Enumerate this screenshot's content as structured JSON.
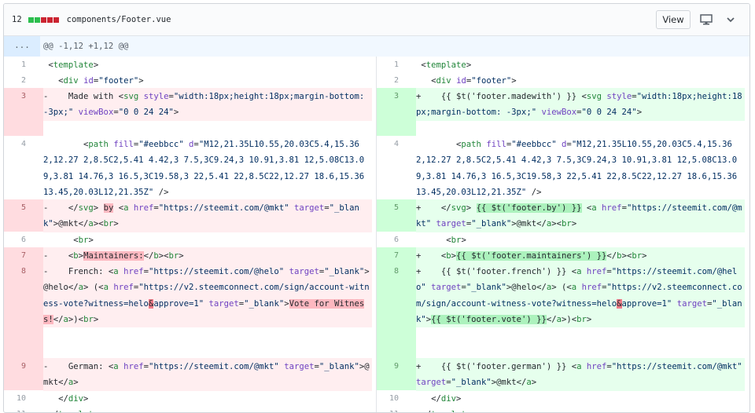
{
  "file": {
    "count": "12",
    "name": "components/Footer.vue",
    "diffstat_colors": [
      "#2cbe4e",
      "#2cbe4e",
      "#cb2431",
      "#cb2431",
      "#cb2431"
    ],
    "view_label": "View",
    "icons": [
      "desktop-icon",
      "chevron-down-icon"
    ]
  },
  "hunk": {
    "marker": "...",
    "header": "@@ -1,12 +1,12 @@"
  },
  "left": [
    {
      "num": "1",
      "text": " <template>"
    },
    {
      "num": "2",
      "text": "   <div id=\"footer\">"
    },
    {
      "num": "3",
      "sign": "-",
      "text": "      Made with <svg style=\"width:18px;height:18px;margin-bottom: -3px;\" viewBox=\"0 0 24 24\">"
    },
    {
      "num": "4",
      "text": "        <path fill=\"#eebbcc\" d=\"M12,21.35L10.55,20.03C5.4,15.36 2,12.27 2,8.5C2,5.41 4.42,3 7.5,3C9.24,3 10.91,3.81 12,5.08C13.09,3.81 14.76,3 16.5,3C19.58,3 22,5.41 22,8.5C22,12.27 18.6,15.36 13.45,20.03L12,21.35Z\" />"
    },
    {
      "num": "5",
      "sign": "-",
      "text": "      </svg> by <a href=\"https://steemit.com/@mkt\" target=\"_blank\">@mkt</a><br>"
    },
    {
      "num": "6",
      "text": "      <br>"
    },
    {
      "num": "7",
      "sign": "-",
      "text": "      <b>Maintainers:</b><br>"
    },
    {
      "num": "8",
      "sign": "-",
      "text": "      French: <a href=\"https://steemit.com/@helo\" target=\"_blank\">@helo</a> (<a href=\"https://v2.steemconnect.com/sign/account-witness-vote?witness=helo&approve=1\" target=\"_blank\">Vote for Witness!</a>)<br>"
    },
    {
      "num": "9",
      "sign": "-",
      "text": "      German: <a href=\"https://steemit.com/@mkt\" target=\"_blank\">@mkt</a>"
    },
    {
      "num": "10",
      "text": "   </div>"
    },
    {
      "num": "11",
      "text": " </template>"
    }
  ],
  "right": [
    {
      "num": "1",
      "text": " <template>"
    },
    {
      "num": "2",
      "text": "   <div id=\"footer\">"
    },
    {
      "num": "3",
      "sign": "+",
      "text": "      {{ $t('footer.madewith') }} <svg style=\"width:18px;height:18px;margin-bottom: -3px;\" viewBox=\"0 0 24 24\">"
    },
    {
      "num": "4",
      "text": "        <path fill=\"#eebbcc\" d=\"M12,21.35L10.55,20.03C5.4,15.36 2,12.27 2,8.5C2,5.41 4.42,3 7.5,3C9.24,3 10.91,3.81 12,5.08C13.09,3.81 14.76,3 16.5,3C19.58,3 22,5.41 22,8.5C22,12.27 18.6,15.36 13.45,20.03L12,21.35Z\" />"
    },
    {
      "num": "5",
      "sign": "+",
      "text": "      </svg> {{ $t('footer.by') }} <a href=\"https://steemit.com/@mkt\" target=\"_blank\">@mkt</a><br>"
    },
    {
      "num": "6",
      "text": "      <br>"
    },
    {
      "num": "7",
      "sign": "+",
      "text": "      <b>{{ $t('footer.maintainers') }}</b><br>"
    },
    {
      "num": "8",
      "sign": "+",
      "text": "      {{ $t('footer.french') }} <a href=\"https://steemit.com/@helo\" target=\"_blank\">@helo</a> (<a href=\"https://v2.steemconnect.com/sign/account-witness-vote?witness=helo&approve=1\" target=\"_blank\">{{ $t('footer.vote') }}</a>)<br>"
    },
    {
      "num": "9",
      "sign": "+",
      "text": "      {{ $t('footer.german') }} <a href=\"https://steemit.com/@mkt\" target=\"_blank\">@mkt</a>"
    },
    {
      "num": "10",
      "text": "   </div>"
    },
    {
      "num": "11",
      "text": " </template>"
    }
  ]
}
